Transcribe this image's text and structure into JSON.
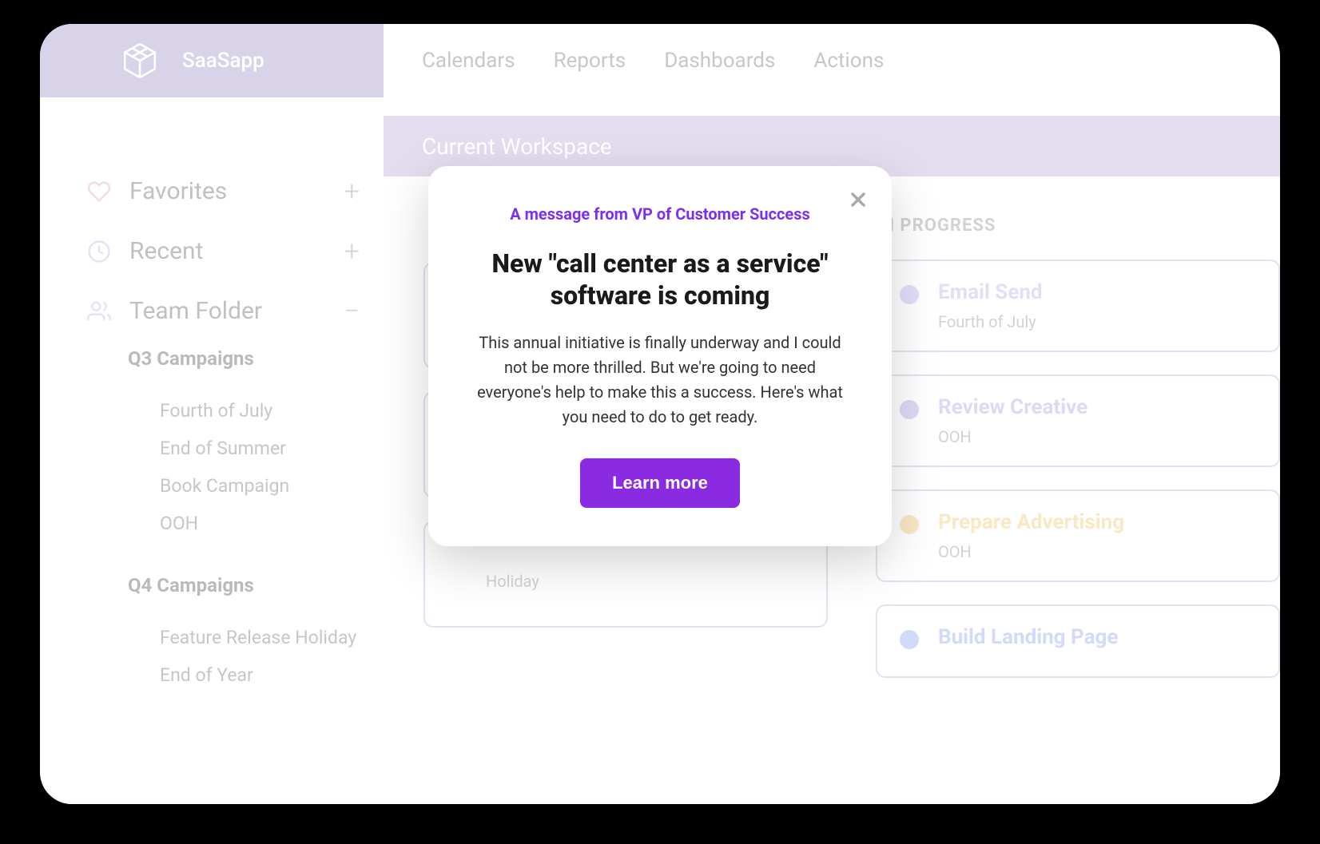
{
  "brand": {
    "name": "SaaSapp"
  },
  "topnav": {
    "items": [
      "Calendars",
      "Reports",
      "Dashboards",
      "Actions"
    ]
  },
  "workspace": {
    "title": "Current Workspace"
  },
  "sidebar": {
    "favorites": {
      "label": "Favorites"
    },
    "recent": {
      "label": "Recent"
    },
    "team": {
      "label": "Team Folder"
    },
    "q3": {
      "header": "Q3 Campaigns",
      "items": [
        "Fourth of July",
        "End of Summer",
        "Book Campaign",
        "OOH"
      ]
    },
    "q4": {
      "header": "Q4 Campaigns",
      "items": [
        "Feature Release Holiday",
        "End of Year"
      ]
    }
  },
  "board": {
    "col1": {
      "header": "",
      "cards": [
        {
          "title": "",
          "sub": ""
        },
        {
          "title": "",
          "sub": ""
        },
        {
          "title": "",
          "sub": "Holiday"
        }
      ]
    },
    "col2": {
      "header": "IN PROGRESS",
      "cards": [
        {
          "title": "Email Send",
          "sub": "Fourth of July",
          "color": "#B9A6F0",
          "titleColor": "#B9A6F0"
        },
        {
          "title": "Review Creative",
          "sub": "OOH",
          "color": "#A99AE8",
          "titleColor": "#A99AE8"
        },
        {
          "title": "Prepare Advertising",
          "sub": "OOH",
          "color": "#F2C162",
          "titleColor": "#F2C162"
        },
        {
          "title": "Build Landing Page",
          "sub": "",
          "color": "#8A9CF0",
          "titleColor": "#8A9CF0"
        }
      ]
    }
  },
  "modal": {
    "eyebrow": "A message from VP of Customer Success",
    "title": "New \"call center as a service\" software is coming",
    "body": "This annual initiative is finally underway and I could not be more thrilled. But we're going to need everyone's help to make this a success. Here's what you need to do to get ready.",
    "cta": "Learn more"
  }
}
